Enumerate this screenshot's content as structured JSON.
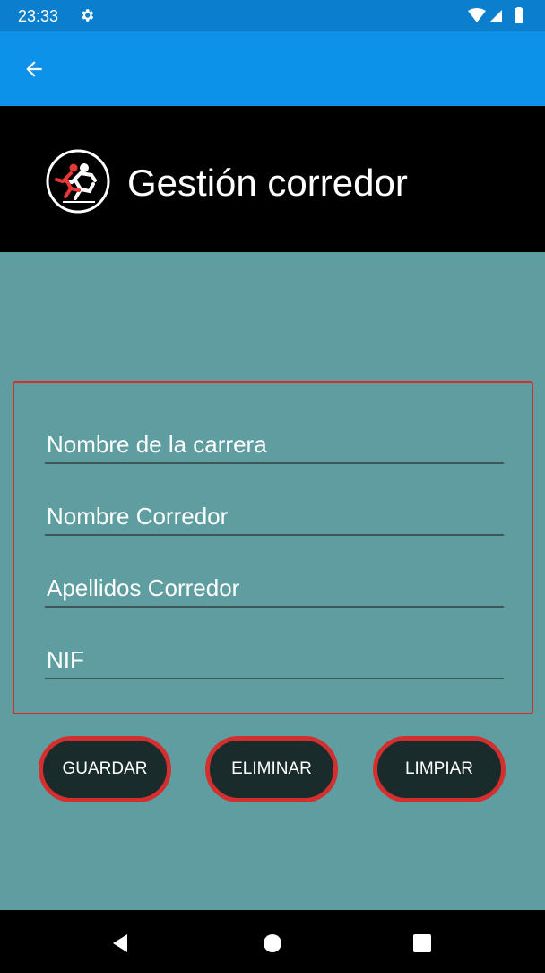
{
  "status_bar": {
    "time": "23:33",
    "icons": [
      "gear-icon",
      "wifi-icon",
      "signal-icon",
      "battery-icon"
    ]
  },
  "app_bar": {
    "back_icon": "arrow-left-icon",
    "color": "#0c93e9"
  },
  "header": {
    "title": "Gestión corredor",
    "logo_icon": "runners-logo-icon"
  },
  "form": {
    "fields": [
      {
        "placeholder": "Nombre de la carrera",
        "value": ""
      },
      {
        "placeholder": "Nombre Corredor",
        "value": ""
      },
      {
        "placeholder": "Apellidos Corredor",
        "value": ""
      },
      {
        "placeholder": "NIF",
        "value": ""
      }
    ],
    "border_color": "#d32f2f"
  },
  "buttons": {
    "save_label": "GUARDAR",
    "delete_label": "ELIMINAR",
    "clear_label": "LIMPIAR"
  },
  "colors": {
    "background": "#5f9ea0",
    "button_fill": "#1a2b2b",
    "button_border": "#d32f2f"
  },
  "nav_bar": {
    "icons": [
      "back-triangle-icon",
      "home-circle-icon",
      "recents-square-icon"
    ]
  }
}
